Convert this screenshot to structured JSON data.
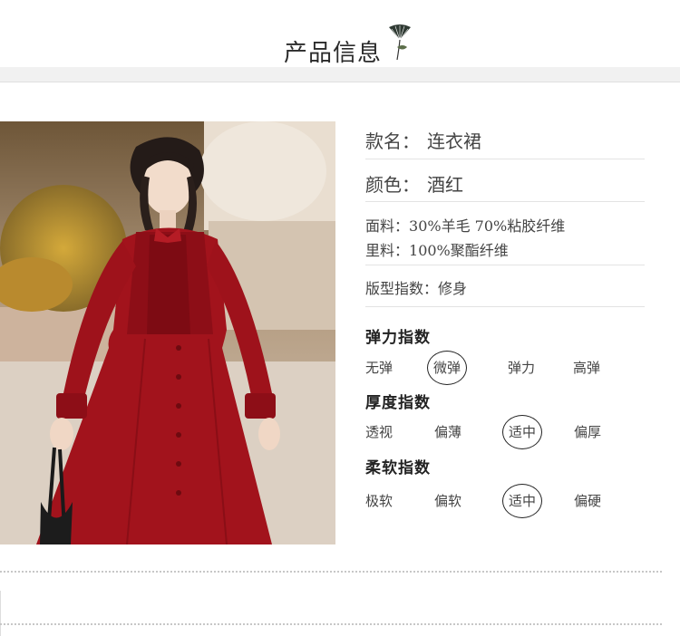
{
  "header": {
    "title": "产品信息"
  },
  "product": {
    "style_label": "款名：",
    "style_value": "连衣裙",
    "color_label": "颜色：",
    "color_value": "酒红",
    "fabric_label": "面料：",
    "fabric_value": "30%羊毛  70%粘胶纤维",
    "lining_label": "里料：",
    "lining_value": "100%聚酯纤维",
    "fit_label": "版型指数：",
    "fit_value": "修身"
  },
  "indices": [
    {
      "title": "弹力指数",
      "options": [
        "无弹",
        "微弹",
        "弹力",
        "高弹"
      ],
      "selected": "微弹"
    },
    {
      "title": "厚度指数",
      "options": [
        "透视",
        "偏薄",
        "适中",
        "偏厚"
      ],
      "selected": "适中"
    },
    {
      "title": "柔软指数",
      "options": [
        "极软",
        "偏软",
        "适中",
        "偏硬"
      ],
      "selected": "适中"
    }
  ],
  "colors": {
    "dress": "#a2131c",
    "background": "#ffffff",
    "band": "#f1f1f1"
  },
  "icons": {
    "header_decoration": "ginkgo-leaf-icon"
  }
}
